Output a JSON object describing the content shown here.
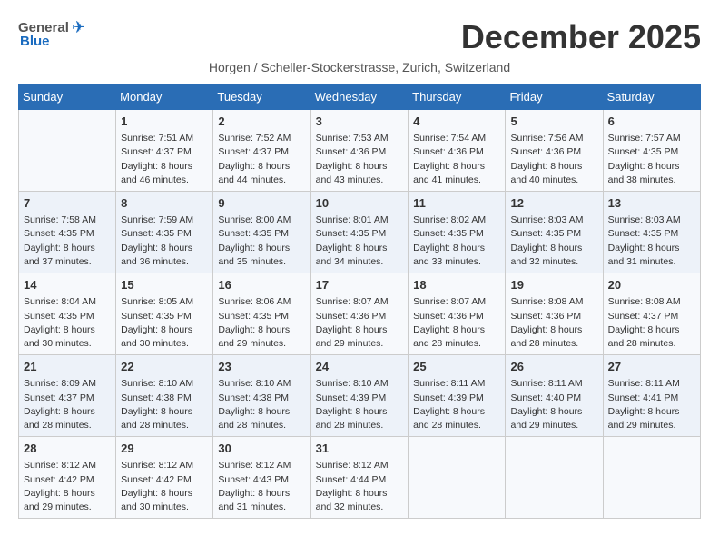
{
  "header": {
    "logo_general": "General",
    "logo_blue": "Blue",
    "month_title": "December 2025",
    "subtitle": "Horgen / Scheller-Stockerstrasse, Zurich, Switzerland"
  },
  "columns": [
    "Sunday",
    "Monday",
    "Tuesday",
    "Wednesday",
    "Thursday",
    "Friday",
    "Saturday"
  ],
  "weeks": [
    [
      {
        "day": "",
        "sunrise": "",
        "sunset": "",
        "daylight": ""
      },
      {
        "day": "1",
        "sunrise": "Sunrise: 7:51 AM",
        "sunset": "Sunset: 4:37 PM",
        "daylight": "Daylight: 8 hours and 46 minutes."
      },
      {
        "day": "2",
        "sunrise": "Sunrise: 7:52 AM",
        "sunset": "Sunset: 4:37 PM",
        "daylight": "Daylight: 8 hours and 44 minutes."
      },
      {
        "day": "3",
        "sunrise": "Sunrise: 7:53 AM",
        "sunset": "Sunset: 4:36 PM",
        "daylight": "Daylight: 8 hours and 43 minutes."
      },
      {
        "day": "4",
        "sunrise": "Sunrise: 7:54 AM",
        "sunset": "Sunset: 4:36 PM",
        "daylight": "Daylight: 8 hours and 41 minutes."
      },
      {
        "day": "5",
        "sunrise": "Sunrise: 7:56 AM",
        "sunset": "Sunset: 4:36 PM",
        "daylight": "Daylight: 8 hours and 40 minutes."
      },
      {
        "day": "6",
        "sunrise": "Sunrise: 7:57 AM",
        "sunset": "Sunset: 4:35 PM",
        "daylight": "Daylight: 8 hours and 38 minutes."
      }
    ],
    [
      {
        "day": "7",
        "sunrise": "Sunrise: 7:58 AM",
        "sunset": "Sunset: 4:35 PM",
        "daylight": "Daylight: 8 hours and 37 minutes."
      },
      {
        "day": "8",
        "sunrise": "Sunrise: 7:59 AM",
        "sunset": "Sunset: 4:35 PM",
        "daylight": "Daylight: 8 hours and 36 minutes."
      },
      {
        "day": "9",
        "sunrise": "Sunrise: 8:00 AM",
        "sunset": "Sunset: 4:35 PM",
        "daylight": "Daylight: 8 hours and 35 minutes."
      },
      {
        "day": "10",
        "sunrise": "Sunrise: 8:01 AM",
        "sunset": "Sunset: 4:35 PM",
        "daylight": "Daylight: 8 hours and 34 minutes."
      },
      {
        "day": "11",
        "sunrise": "Sunrise: 8:02 AM",
        "sunset": "Sunset: 4:35 PM",
        "daylight": "Daylight: 8 hours and 33 minutes."
      },
      {
        "day": "12",
        "sunrise": "Sunrise: 8:03 AM",
        "sunset": "Sunset: 4:35 PM",
        "daylight": "Daylight: 8 hours and 32 minutes."
      },
      {
        "day": "13",
        "sunrise": "Sunrise: 8:03 AM",
        "sunset": "Sunset: 4:35 PM",
        "daylight": "Daylight: 8 hours and 31 minutes."
      }
    ],
    [
      {
        "day": "14",
        "sunrise": "Sunrise: 8:04 AM",
        "sunset": "Sunset: 4:35 PM",
        "daylight": "Daylight: 8 hours and 30 minutes."
      },
      {
        "day": "15",
        "sunrise": "Sunrise: 8:05 AM",
        "sunset": "Sunset: 4:35 PM",
        "daylight": "Daylight: 8 hours and 30 minutes."
      },
      {
        "day": "16",
        "sunrise": "Sunrise: 8:06 AM",
        "sunset": "Sunset: 4:35 PM",
        "daylight": "Daylight: 8 hours and 29 minutes."
      },
      {
        "day": "17",
        "sunrise": "Sunrise: 8:07 AM",
        "sunset": "Sunset: 4:36 PM",
        "daylight": "Daylight: 8 hours and 29 minutes."
      },
      {
        "day": "18",
        "sunrise": "Sunrise: 8:07 AM",
        "sunset": "Sunset: 4:36 PM",
        "daylight": "Daylight: 8 hours and 28 minutes."
      },
      {
        "day": "19",
        "sunrise": "Sunrise: 8:08 AM",
        "sunset": "Sunset: 4:36 PM",
        "daylight": "Daylight: 8 hours and 28 minutes."
      },
      {
        "day": "20",
        "sunrise": "Sunrise: 8:08 AM",
        "sunset": "Sunset: 4:37 PM",
        "daylight": "Daylight: 8 hours and 28 minutes."
      }
    ],
    [
      {
        "day": "21",
        "sunrise": "Sunrise: 8:09 AM",
        "sunset": "Sunset: 4:37 PM",
        "daylight": "Daylight: 8 hours and 28 minutes."
      },
      {
        "day": "22",
        "sunrise": "Sunrise: 8:10 AM",
        "sunset": "Sunset: 4:38 PM",
        "daylight": "Daylight: 8 hours and 28 minutes."
      },
      {
        "day": "23",
        "sunrise": "Sunrise: 8:10 AM",
        "sunset": "Sunset: 4:38 PM",
        "daylight": "Daylight: 8 hours and 28 minutes."
      },
      {
        "day": "24",
        "sunrise": "Sunrise: 8:10 AM",
        "sunset": "Sunset: 4:39 PM",
        "daylight": "Daylight: 8 hours and 28 minutes."
      },
      {
        "day": "25",
        "sunrise": "Sunrise: 8:11 AM",
        "sunset": "Sunset: 4:39 PM",
        "daylight": "Daylight: 8 hours and 28 minutes."
      },
      {
        "day": "26",
        "sunrise": "Sunrise: 8:11 AM",
        "sunset": "Sunset: 4:40 PM",
        "daylight": "Daylight: 8 hours and 29 minutes."
      },
      {
        "day": "27",
        "sunrise": "Sunrise: 8:11 AM",
        "sunset": "Sunset: 4:41 PM",
        "daylight": "Daylight: 8 hours and 29 minutes."
      }
    ],
    [
      {
        "day": "28",
        "sunrise": "Sunrise: 8:12 AM",
        "sunset": "Sunset: 4:42 PM",
        "daylight": "Daylight: 8 hours and 29 minutes."
      },
      {
        "day": "29",
        "sunrise": "Sunrise: 8:12 AM",
        "sunset": "Sunset: 4:42 PM",
        "daylight": "Daylight: 8 hours and 30 minutes."
      },
      {
        "day": "30",
        "sunrise": "Sunrise: 8:12 AM",
        "sunset": "Sunset: 4:43 PM",
        "daylight": "Daylight: 8 hours and 31 minutes."
      },
      {
        "day": "31",
        "sunrise": "Sunrise: 8:12 AM",
        "sunset": "Sunset: 4:44 PM",
        "daylight": "Daylight: 8 hours and 32 minutes."
      },
      {
        "day": "",
        "sunrise": "",
        "sunset": "",
        "daylight": ""
      },
      {
        "day": "",
        "sunrise": "",
        "sunset": "",
        "daylight": ""
      },
      {
        "day": "",
        "sunrise": "",
        "sunset": "",
        "daylight": ""
      }
    ]
  ]
}
